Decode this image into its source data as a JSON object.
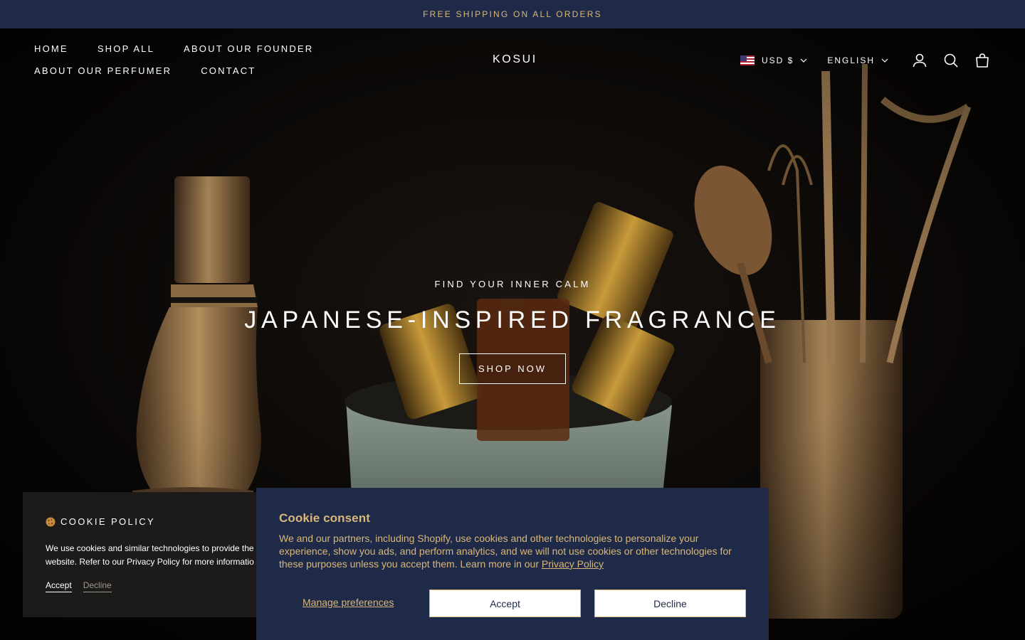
{
  "announcement": {
    "text": "FREE SHIPPING ON ALL ORDERS"
  },
  "nav": {
    "items": [
      {
        "label": "HOME"
      },
      {
        "label": "SHOP ALL"
      },
      {
        "label": "ABOUT OUR FOUNDER"
      },
      {
        "label": "ABOUT OUR PERFUMER"
      },
      {
        "label": "CONTACT"
      }
    ]
  },
  "brand": {
    "logo": "KOSUI"
  },
  "header_tools": {
    "currency": "USD $",
    "language": "ENGLISH",
    "icons": [
      "us-flag-icon",
      "account-icon",
      "search-icon",
      "cart-bag-icon"
    ]
  },
  "hero": {
    "kicker": "FIND YOUR INNER CALM",
    "headline": "JAPANESE-INSPIRED FRAGRANCE",
    "cta": "SHOP NOW"
  },
  "cookie_policy": {
    "title": "COOKIE POLICY",
    "text_line1": "We use cookies and similar technologies to provide the",
    "text_line2": "website. Refer to our Privacy Policy for more informatio",
    "accept": "Accept",
    "decline": "Decline"
  },
  "cookie_consent": {
    "title": "Cookie consent",
    "body": "We and our partners, including Shopify, use cookies and other technologies to personalize your experience, show you ads, and perform analytics, and we will not use cookies or other technologies for these purposes unless you accept them. Learn more in our ",
    "privacy_link": "Privacy Policy",
    "manage": "Manage preferences",
    "accept": "Accept",
    "decline": "Decline"
  },
  "colors": {
    "navy": "#1e2a47",
    "gold": "#d9b779",
    "policy_bg": "#1d1b1a"
  }
}
